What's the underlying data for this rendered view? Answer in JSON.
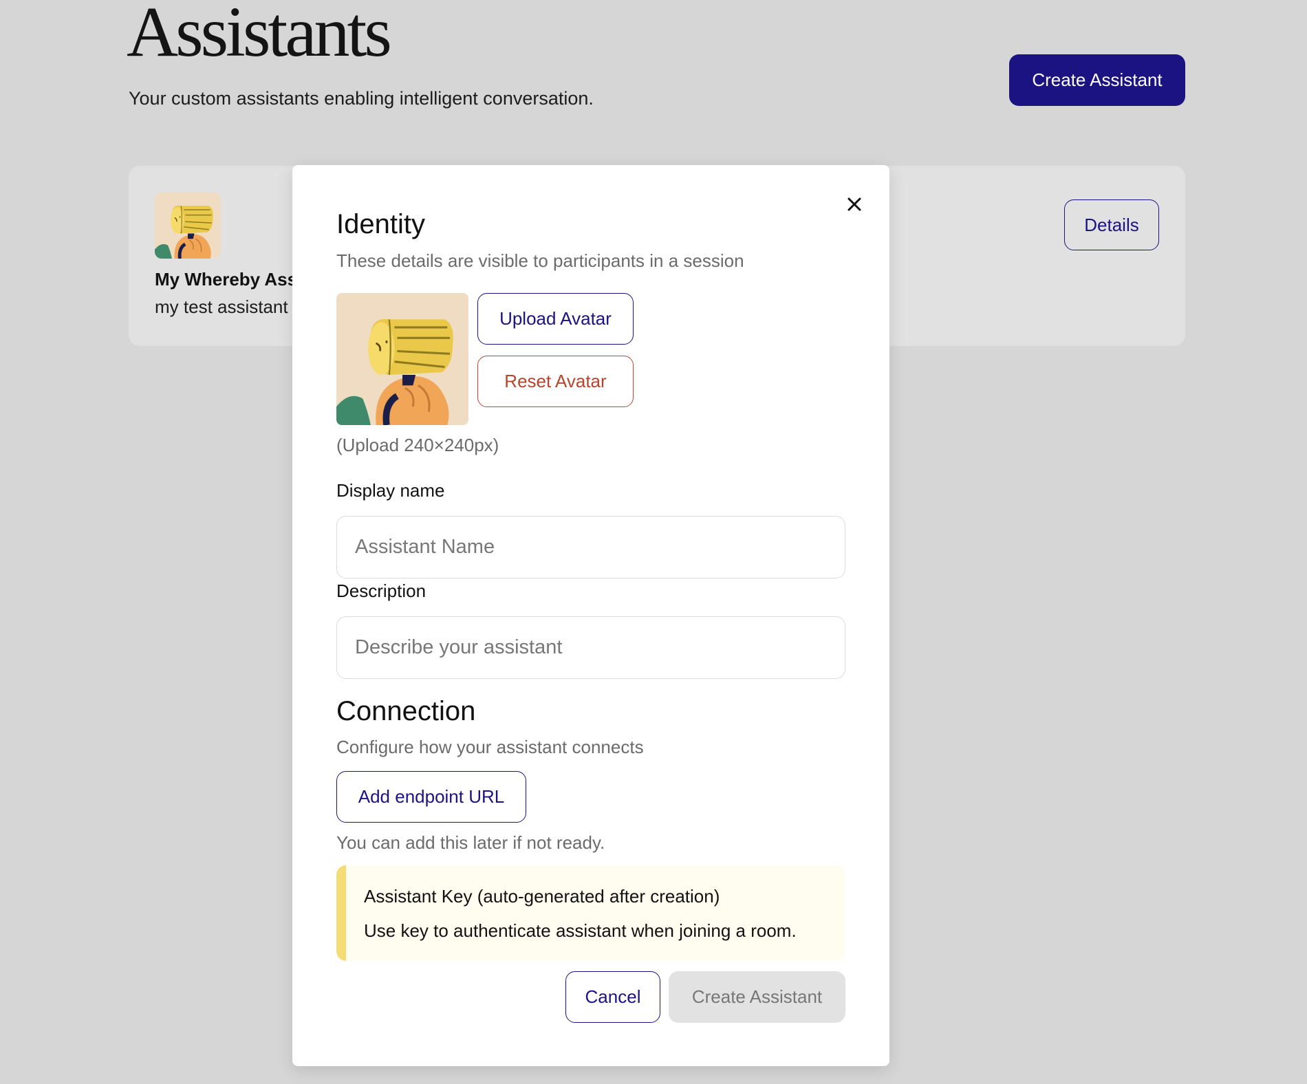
{
  "page": {
    "title": "Assistants",
    "subtitle": "Your custom assistants enabling intelligent conversation.",
    "create_button_label": "Create Assistant"
  },
  "assistant_card": {
    "name": "My Whereby Ass",
    "description": "my test assistant",
    "details_label": "Details",
    "avatar_icon": "log-head-avatar-icon"
  },
  "modal": {
    "close_icon": "close-icon",
    "identity": {
      "title": "Identity",
      "subtitle": "These details are visible to participants in a session",
      "upload_label": "Upload Avatar",
      "reset_label": "Reset Avatar",
      "upload_hint": "(Upload 240×240px)",
      "display_name_label": "Display name",
      "display_name_placeholder": "Assistant Name",
      "display_name_value": "",
      "description_label": "Description",
      "description_placeholder": "Describe your assistant",
      "description_value": ""
    },
    "connection": {
      "title": "Connection",
      "subtitle": "Configure how your assistant connects",
      "endpoint_label": "Add endpoint URL",
      "later_hint": "You can add this later if not ready."
    },
    "key_notice": {
      "title": "Assistant Key (auto-generated after creation)",
      "description": "Use key to authenticate assistant when joining a room."
    },
    "cancel_label": "Cancel",
    "create_label": "Create Assistant"
  },
  "colors": {
    "primary": "#1c1382",
    "danger": "#b8442c",
    "notice_bar": "#f6dc76",
    "notice_bg": "#fffcf0",
    "backdrop": "#d6d6d6"
  }
}
